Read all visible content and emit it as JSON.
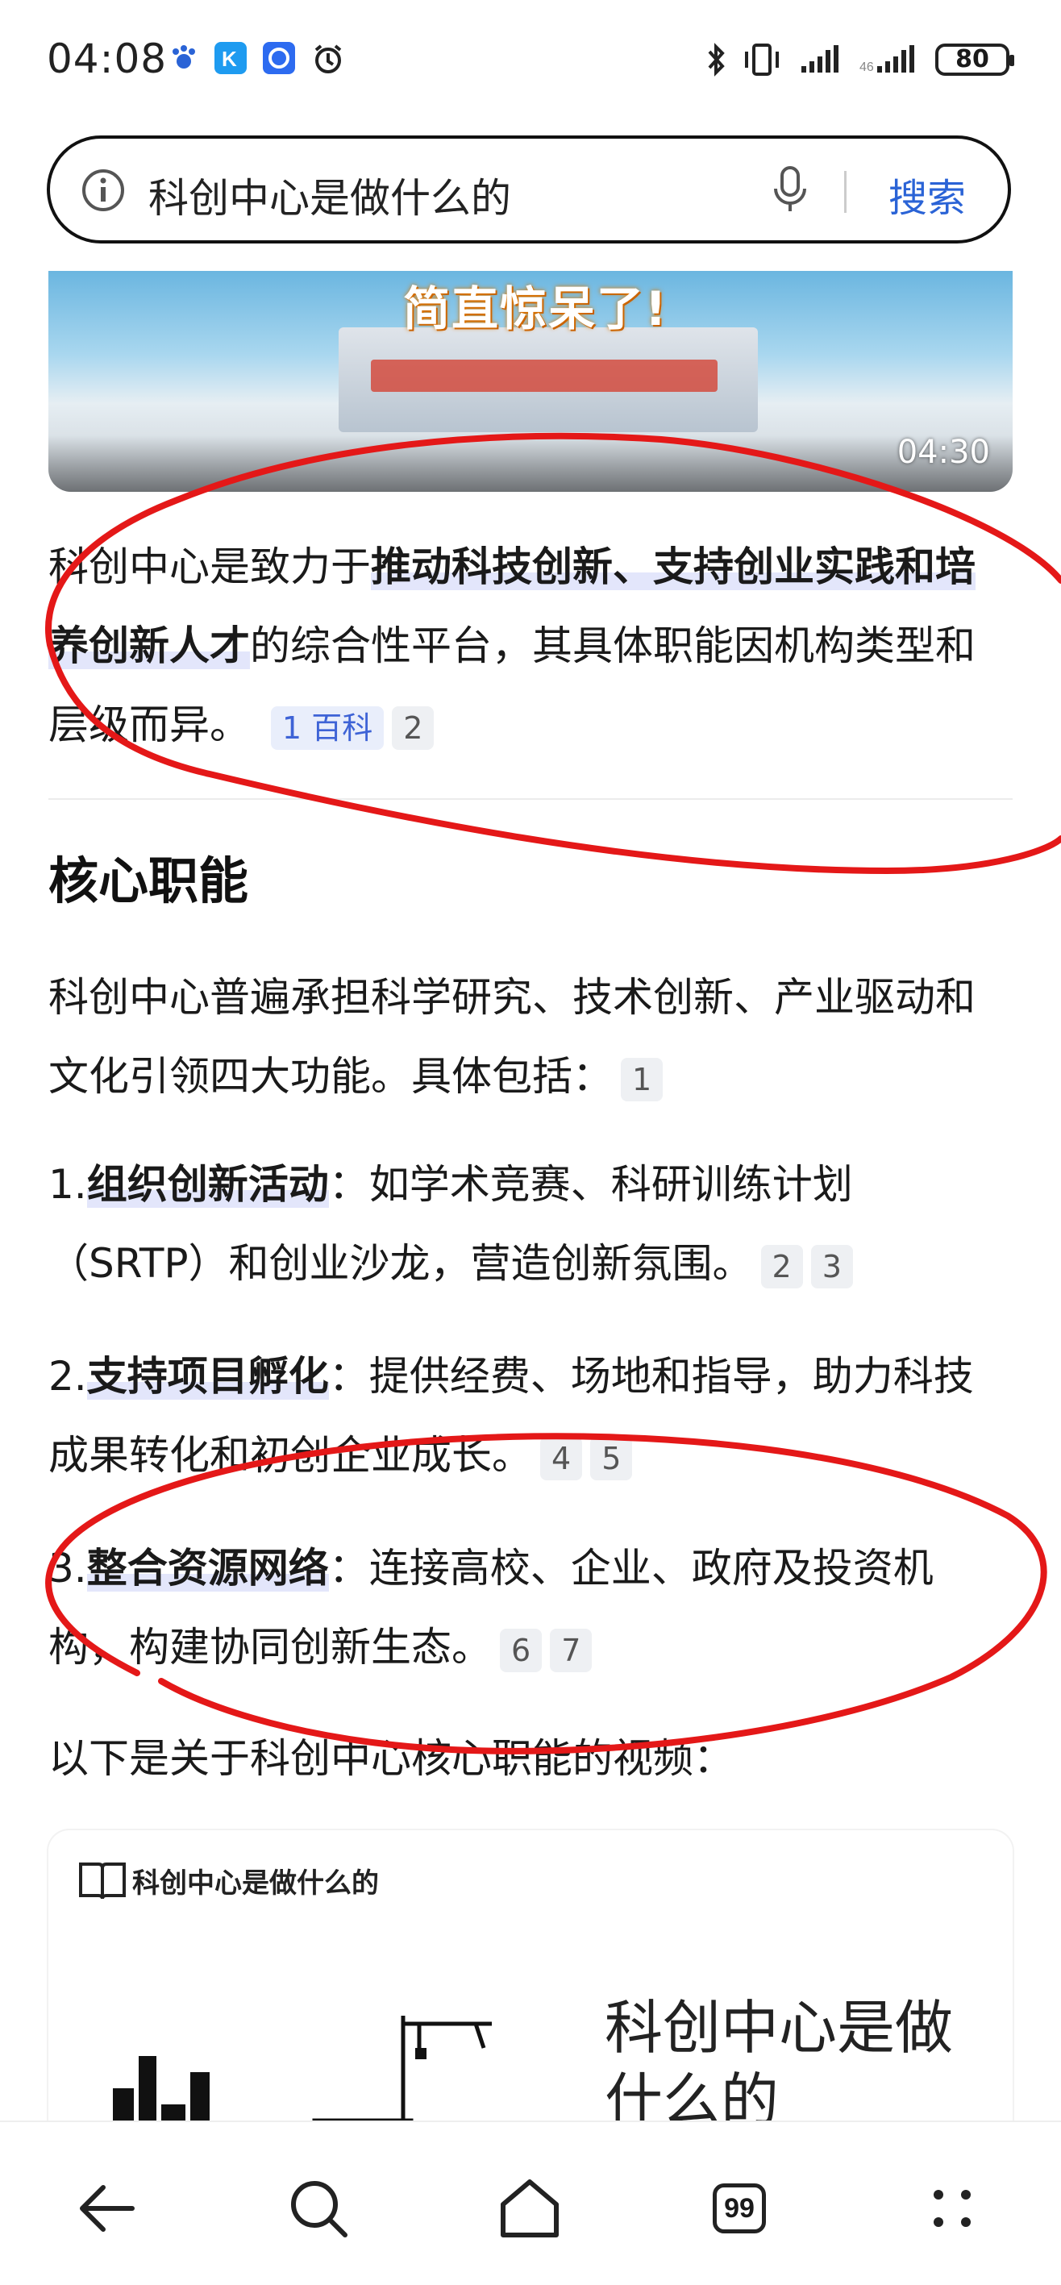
{
  "status_bar": {
    "time": "04:08",
    "battery": "80"
  },
  "search": {
    "query": "科创中心是做什么的",
    "button": "搜索"
  },
  "video": {
    "caption": "简直惊呆了!",
    "duration": "04:30"
  },
  "intro": {
    "pre": "科创中心是致力于",
    "bold": "推动科技创新、支持创业实践和培养创新人才",
    "post": "的综合性平台，其具体职能因机构类型和层级而异。",
    "cite1": "1",
    "cite1_src": "百科",
    "cite2": "2"
  },
  "section": {
    "heading": "核心职能",
    "lead": "科创中心普遍承担科学研究、技术创新、产业驱动和文化引领四大功能。具体包括：",
    "lead_cite": "1",
    "items": [
      {
        "num": "1.",
        "title": "组织创新活动",
        "text": "：如学术竞赛、科研训练计划（SRTP）和创业沙龙，营造创新氛围。",
        "cites": [
          "2",
          "3"
        ]
      },
      {
        "num": "2.",
        "title": "支持项目孵化",
        "text": "：提供经费、场地和指导，助力科技成果转化和初创企业成长。",
        "cites": [
          "4",
          "5"
        ]
      },
      {
        "num": "3.",
        "title": "整合资源网络",
        "text": "：连接高校、企业、政府及投资机构，构建协同创新生态。",
        "cites": [
          "6",
          "7"
        ]
      }
    ],
    "video_intro": "以下是关于科创中心核心职能的视频："
  },
  "card2": {
    "title": "科创中心是做什么的",
    "big_line1": "科创中心是做",
    "big_line2": "什么的"
  },
  "nav": {
    "tabs_count": "99"
  },
  "colors": {
    "accent": "#2a63d6",
    "highlight": "#e3e6fb",
    "annotation": "#e41818"
  }
}
